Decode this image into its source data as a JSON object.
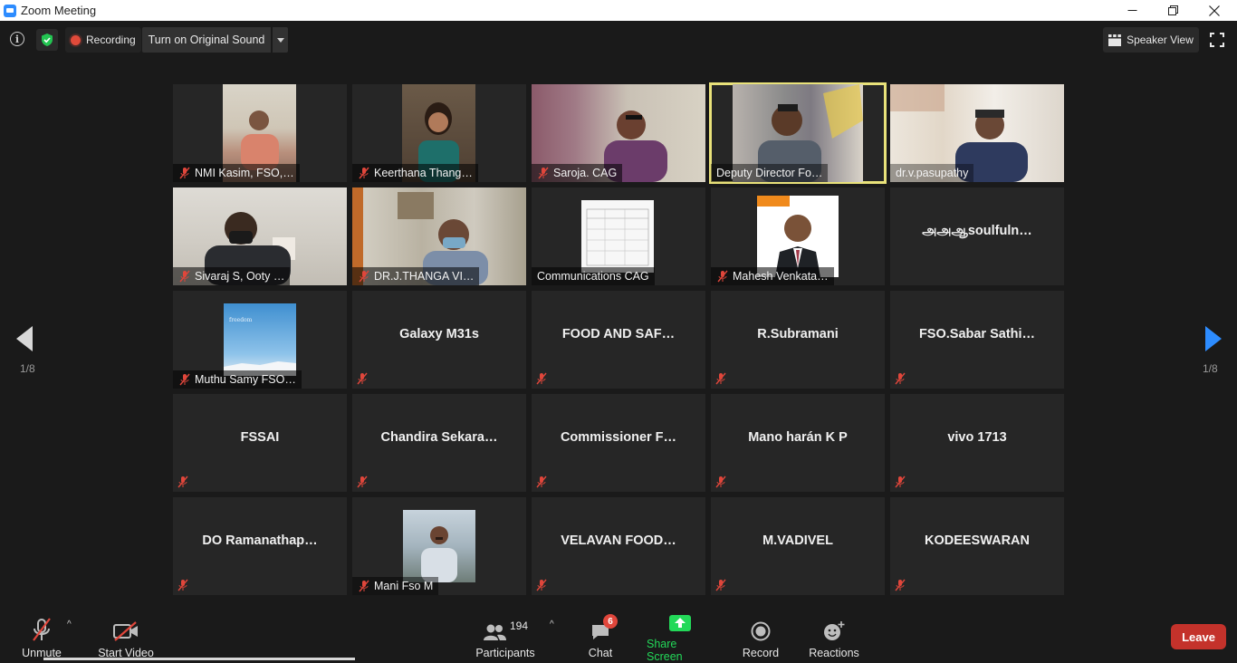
{
  "window": {
    "title": "Zoom Meeting"
  },
  "topbar": {
    "recording_label": "Recording",
    "original_sound_label": "Turn on Original Sound",
    "view_label": "Speaker View"
  },
  "pagination": {
    "left_indicator": "1/8",
    "right_indicator": "1/8"
  },
  "participants": [
    {
      "name": "NMI Kasim, FSO,…",
      "has_video": true,
      "muted": true
    },
    {
      "name": "Keerthana Thang…",
      "has_video": true,
      "muted": true
    },
    {
      "name": "Saroja. CAG",
      "has_video": true,
      "muted": true
    },
    {
      "name": "Deputy Director Fo…",
      "has_video": true,
      "muted": false,
      "active_speaker": true
    },
    {
      "name": "dr.v.pasupathy",
      "has_video": true,
      "muted": false
    },
    {
      "name": "Sivaraj S, Ooty …",
      "has_video": true,
      "muted": true
    },
    {
      "name": "DR.J.THANGA VI…",
      "has_video": true,
      "muted": true
    },
    {
      "name": "Communications CAG",
      "has_video": true,
      "muted": false
    },
    {
      "name": "Mahesh Venkata…",
      "has_video": true,
      "muted": true
    },
    {
      "name": "அஅஆsoulfuln…",
      "has_video": false,
      "muted": false
    },
    {
      "name": "Muthu Samy FSO…",
      "has_video": true,
      "muted": true
    },
    {
      "name": "Galaxy M31s",
      "has_video": false,
      "muted": true
    },
    {
      "name": "FOOD AND SAF…",
      "has_video": false,
      "muted": true
    },
    {
      "name": "R.Subramani",
      "has_video": false,
      "muted": true
    },
    {
      "name": "FSO.Sabar Sathi…",
      "has_video": false,
      "muted": true
    },
    {
      "name": "FSSAI",
      "has_video": false,
      "muted": true
    },
    {
      "name": "Chandira Sekara…",
      "has_video": false,
      "muted": true
    },
    {
      "name": "Commissioner F…",
      "has_video": false,
      "muted": true
    },
    {
      "name": "Mano harán K P",
      "has_video": false,
      "muted": true
    },
    {
      "name": "vivo 1713",
      "has_video": false,
      "muted": true
    },
    {
      "name": "DO Ramanathap…",
      "has_video": false,
      "muted": true
    },
    {
      "name": "Mani Fso M",
      "has_video": true,
      "muted": true
    },
    {
      "name": "VELAVAN FOOD…",
      "has_video": false,
      "muted": true
    },
    {
      "name": "M.VADIVEL",
      "has_video": false,
      "muted": true
    },
    {
      "name": "KODEESWARAN",
      "has_video": false,
      "muted": true
    }
  ],
  "toolbar": {
    "unmute_label": "Unmute",
    "start_video_label": "Start Video",
    "participants_label": "Participants",
    "participants_count": "194",
    "chat_label": "Chat",
    "chat_badge": "6",
    "share_screen_label": "Share Screen",
    "record_label": "Record",
    "reactions_label": "Reactions",
    "leave_label": "Leave"
  },
  "colors": {
    "background": "#1a1a1a",
    "tile": "#262626",
    "active_speaker_border": "#e9e27a",
    "share_green": "#23d959",
    "leave_red": "#c4322b",
    "accent_blue": "#2d8cff"
  }
}
